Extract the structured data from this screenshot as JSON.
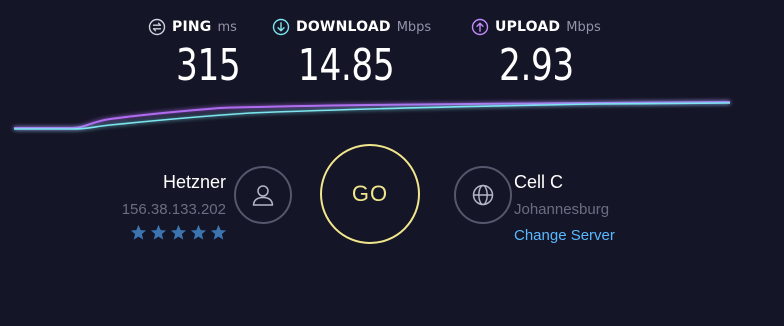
{
  "metrics": {
    "ping": {
      "label": "PING",
      "unit": "ms",
      "value": "315",
      "icon": "ping-icon",
      "color": "#cfd2e0"
    },
    "download": {
      "label": "DOWNLOAD",
      "unit": "Mbps",
      "value": "14.85",
      "icon": "download-arrow-icon",
      "color": "#7de5ef"
    },
    "upload": {
      "label": "UPLOAD",
      "unit": "Mbps",
      "value": "2.93",
      "icon": "upload-arrow-icon",
      "color": "#c38cff"
    }
  },
  "graph": {
    "download_color": "#7de5ef",
    "upload_color": "#b06cf0"
  },
  "isp": {
    "name": "Hetzner",
    "ip": "156.38.133.202",
    "rating": 5,
    "star_color": "#3c74b0",
    "icon": "user-icon"
  },
  "go_button": {
    "label": "GO",
    "color": "#f2e68c"
  },
  "server": {
    "name": "Cell C",
    "location": "Johannesburg",
    "change_label": "Change Server",
    "link_color": "#5bb8ff",
    "icon": "globe-icon"
  }
}
